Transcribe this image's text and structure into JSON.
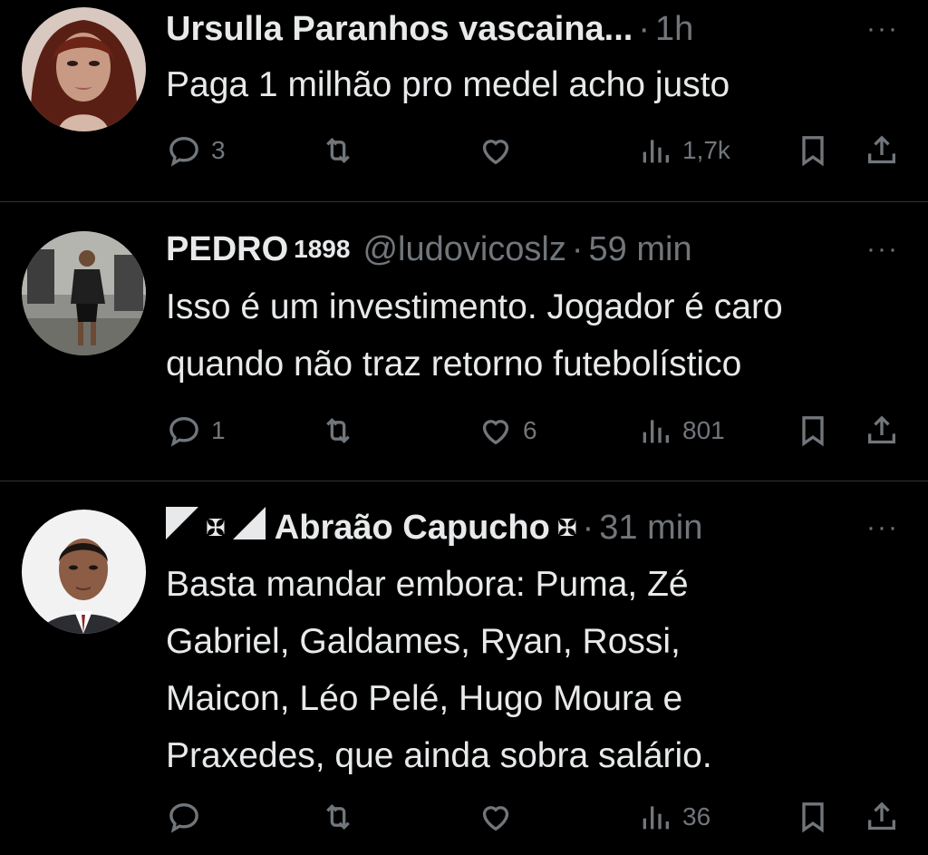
{
  "tweets": [
    {
      "name": "Ursulla Paranhos vascaina...",
      "handle": "",
      "time": "1h",
      "text": "Paga 1 milhão pro medel acho justo",
      "replies": "3",
      "retweets": "",
      "likes": "",
      "views": "1,7k"
    },
    {
      "name": "PEDRO",
      "name_suffix": "1898",
      "handle": "@ludovicoslz",
      "time": "59 min",
      "text": "Isso é um investimento. Jogador é caro\nquando não traz retorno futebolístico",
      "replies": "1",
      "retweets": "",
      "likes": "6",
      "views": "801"
    },
    {
      "name": "Abraão Capucho",
      "name_prefix_symbol": "✠",
      "name_suffix_symbol": "✠",
      "handle": "",
      "time": "31 min",
      "text": "Basta mandar embora: Puma, Zé\nGabriel, Galdames, Ryan, Rossi,\nMaicon, Léo Pelé, Hugo Moura e\nPraxedes, que ainda sobra salário.",
      "replies": "",
      "retweets": "",
      "likes": "",
      "views": "36"
    }
  ],
  "more_label": "···",
  "colors": {
    "background": "#000000",
    "primary_text": "#e7e9ea",
    "secondary_text": "#71767b",
    "divider": "#2f3336"
  },
  "icons": [
    "reply-icon",
    "retweet-icon",
    "like-icon",
    "views-icon",
    "bookmark-icon",
    "share-icon",
    "more-icon"
  ]
}
